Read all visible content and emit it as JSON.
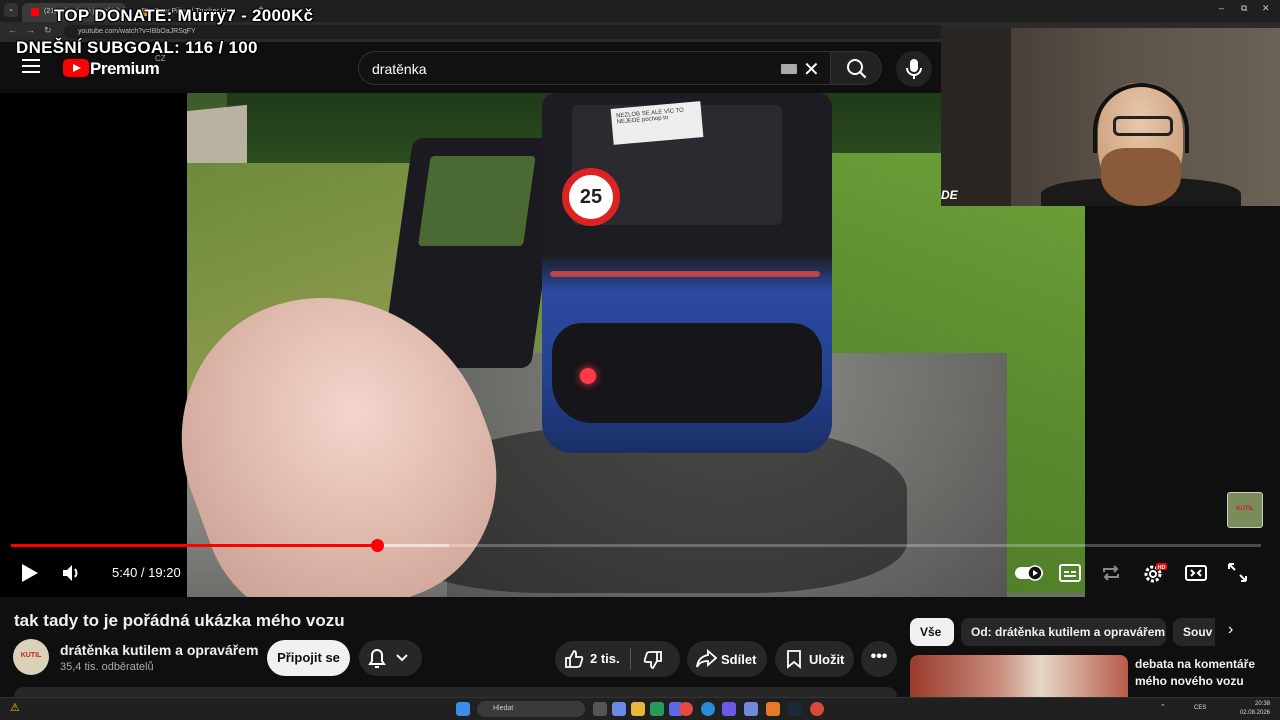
{
  "browser": {
    "tabs": [
      {
        "label": "(21) tak tady to je pořádná",
        "favicon_color": "#ff0000",
        "active": true
      },
      {
        "label": "Fatty Pillow | Trucker Hat",
        "favicon_color": "#e0a030",
        "active": false
      }
    ],
    "tab_menu_icon": "⌄",
    "new_tab": "+",
    "tab_close": "×",
    "window_controls": {
      "minimize": "–",
      "maximize": "⧉",
      "close": "✕"
    },
    "nav": {
      "back": "←",
      "forward": "→",
      "reload": "↻"
    },
    "url": "youtube.com/watch?v=IBbOaJRSqFY"
  },
  "overlay": {
    "donate": "TOP DONATE: Murry7 - 2000Kč",
    "subgoal": "DNEŠNÍ SUBGOAL: 116 / 100"
  },
  "masthead": {
    "logo_text": "Premium",
    "country_code": "CZ",
    "search_value": "dratěnka",
    "clear_icon": "✕"
  },
  "video": {
    "sign_text": "NEZLOB SE ALE VÍC TO NEJEDE pochop to",
    "speed_limit": "25",
    "watermark_text": "KUTIL",
    "channel_avatar_text": "KUTIL"
  },
  "player": {
    "current_time": "5:40",
    "duration": "19:20",
    "time_display": "5:40 / 19:20",
    "played_fraction": 0.2931,
    "buffered_fraction": 0.35,
    "settings_badge": "HD"
  },
  "webcam": {
    "logo": "DE"
  },
  "below": {
    "title": "tak tady to je pořádná ukázka mého vozu",
    "channel_name": "drátěnka kutilem a opravářem",
    "subscribers": "35,4 tis. odběratelů",
    "join_label": "Připojit se",
    "like_count": "2 tis.",
    "share_label": "Sdílet",
    "save_label": "Uložit",
    "more_label": "•••"
  },
  "sidebar": {
    "chips": [
      "Vše",
      "Od: drátěnka kutilem a opravářem",
      "Souv"
    ],
    "chip_next": "›",
    "recommendation_title": "debata na komentáře mého nového vozu"
  },
  "taskbar": {
    "warning_icon": "⚠",
    "search_placeholder": "Hledat",
    "tray_arrow": "⌃",
    "language": "CES",
    "time": "20:38",
    "date": "02.08.2026"
  },
  "colors": {
    "youtube_red": "#ff0000",
    "background": "#0f0f0f",
    "pill_bg": "#272727"
  }
}
